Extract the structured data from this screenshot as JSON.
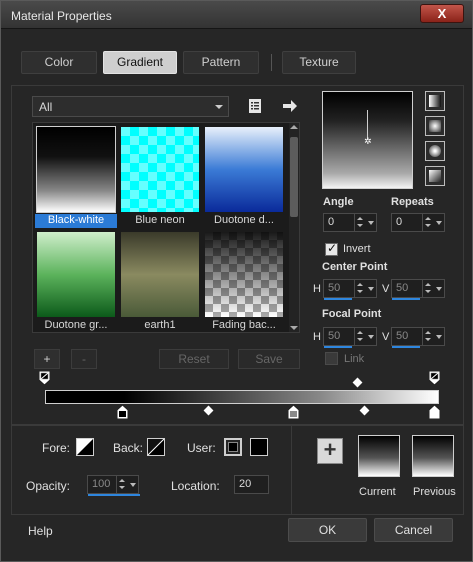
{
  "window": {
    "title": "Material Properties",
    "close_label": "X"
  },
  "tabs": [
    {
      "label": "Color",
      "active": false
    },
    {
      "label": "Gradient",
      "active": true
    },
    {
      "label": "Pattern",
      "active": false
    },
    {
      "label": "Texture",
      "active": false
    }
  ],
  "category": {
    "value": "All"
  },
  "swatches": [
    {
      "label": "Black-white",
      "selected": true
    },
    {
      "label": "Blue neon",
      "selected": false
    },
    {
      "label": "Duotone d...",
      "selected": false
    },
    {
      "label": "Duotone gr...",
      "selected": false
    },
    {
      "label": "earth1",
      "selected": false
    },
    {
      "label": "Fading bac...",
      "selected": false
    }
  ],
  "list_buttons": {
    "add": "+",
    "remove": "-",
    "reset": "Reset",
    "save": "Save"
  },
  "angle": {
    "label": "Angle",
    "value": "0"
  },
  "repeats": {
    "label": "Repeats",
    "value": "0"
  },
  "invert": {
    "label": "Invert",
    "checked": true
  },
  "center_point": {
    "label": "Center Point",
    "h_label": "H",
    "h_value": "50",
    "v_label": "V",
    "v_value": "50"
  },
  "focal_point": {
    "label": "Focal Point",
    "h_label": "H",
    "h_value": "50",
    "v_label": "V",
    "v_value": "50"
  },
  "link": {
    "label": "Link",
    "checked": false
  },
  "editor": {
    "fore_label": "Fore:",
    "back_label": "Back:",
    "user_label": "User:",
    "opacity_label": "Opacity:",
    "opacity_value": "100",
    "location_label": "Location:",
    "location_value": "20"
  },
  "previews": {
    "current_label": "Current",
    "previous_label": "Previous",
    "add_label": "+"
  },
  "footer": {
    "help": "Help",
    "ok": "OK",
    "cancel": "Cancel"
  },
  "colors": {
    "accent": "#2b7bd6",
    "background": "#262626"
  }
}
